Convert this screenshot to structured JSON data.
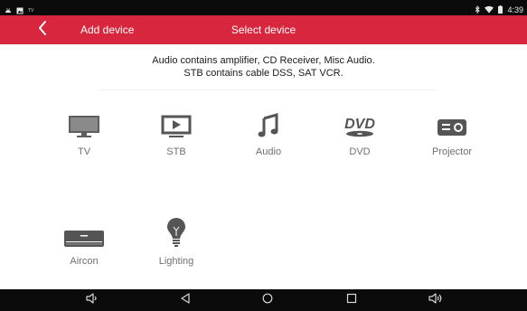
{
  "status_bar": {
    "left_label": "TV",
    "time": "4:39",
    "icons": [
      "android-notification-icon",
      "image-notification-icon",
      "bluetooth-icon",
      "wifi-icon",
      "battery-icon"
    ]
  },
  "header": {
    "back_icon": "chevron-left-icon",
    "left_title": "Add device",
    "center_title": "Select device",
    "background_color": "#d7263d"
  },
  "info": {
    "line1": "Audio contains amplifier, CD Receiver, Misc Audio.",
    "line2": "STB contains cable DSS, SAT VCR."
  },
  "devices": [
    {
      "label": "TV",
      "icon": "tv-icon"
    },
    {
      "label": "STB",
      "icon": "stb-icon"
    },
    {
      "label": "Audio",
      "icon": "music-note-icon"
    },
    {
      "label": "DVD",
      "icon": "dvd-icon"
    },
    {
      "label": "Projector",
      "icon": "projector-icon"
    },
    {
      "label": "Aircon",
      "icon": "air-conditioner-icon"
    },
    {
      "label": "Lighting",
      "icon": "light-bulb-icon"
    }
  ],
  "nav_bar": {
    "buttons": [
      "volume-down-icon",
      "back-triangle-icon",
      "home-circle-icon",
      "recents-square-icon",
      "volume-up-icon"
    ]
  }
}
